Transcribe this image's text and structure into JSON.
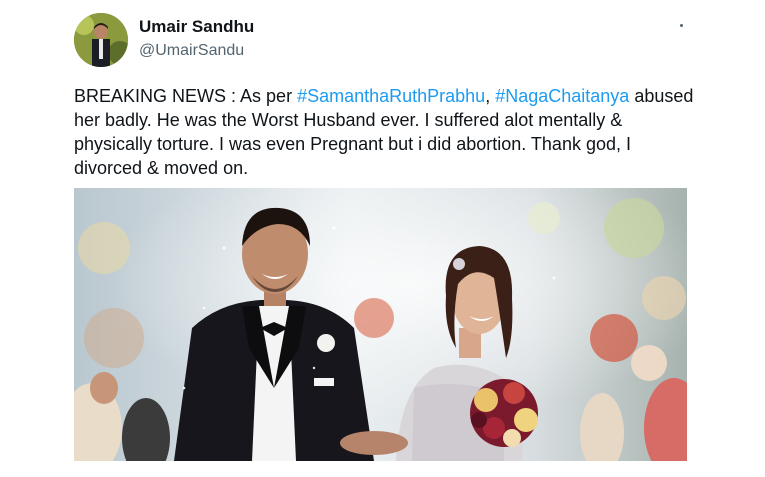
{
  "tweet": {
    "author": {
      "display_name": "Umair Sandhu",
      "handle": "@UmairSandu",
      "avatar_icon": "user-avatar"
    },
    "more_icon": "more-dots-icon",
    "text": {
      "line_parts": [
        {
          "type": "text",
          "value": "BREAKING NEWS : As per "
        },
        {
          "type": "hashtag",
          "value": "#SamanthaRuthPrabhu"
        },
        {
          "type": "text",
          "value": ", "
        },
        {
          "type": "hashtag",
          "value": "#NagaChaitanya"
        },
        {
          "type": "text",
          "value": " abused her badly. He was the Worst Husband ever. I suffered alot mentally & physically torture. I was even Pregnant but i did abortion. Thank god, I divorced & moved on."
        }
      ]
    },
    "media": {
      "alt_icon": "wedding-photo-image"
    },
    "colors": {
      "link": "#1d9bf0",
      "text": "#0f1419",
      "secondary": "#536471"
    }
  }
}
